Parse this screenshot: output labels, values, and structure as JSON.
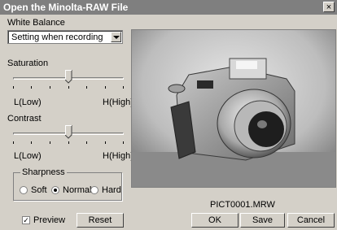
{
  "window": {
    "title": "Open the Minolta-RAW File",
    "close_glyph": "×"
  },
  "white_balance": {
    "label": "White Balance",
    "value": "Setting when recording"
  },
  "saturation": {
    "label": "Saturation",
    "min_label": "L(Low)",
    "max_label": "H(High)",
    "level": 0.5
  },
  "contrast": {
    "label": "Contrast",
    "min_label": "L(Low)",
    "max_label": "H(High)",
    "level": 0.5
  },
  "sharpness": {
    "label": "Sharpness",
    "options": [
      "Soft",
      "Normal",
      "Hard"
    ],
    "selected": "Normal"
  },
  "preview_check": {
    "label": "Preview",
    "checked": true,
    "mark": "✓"
  },
  "buttons": {
    "reset": "Reset",
    "ok": "OK",
    "save": "Save",
    "cancel": "Cancel"
  },
  "file_name": "PICT0001.MRW"
}
